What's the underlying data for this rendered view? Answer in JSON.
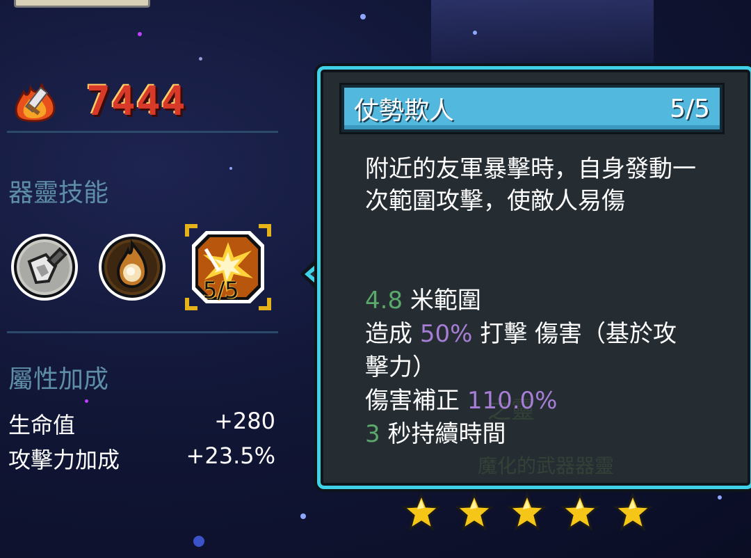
{
  "power": {
    "value": "7444",
    "icon": "flame-sword-icon"
  },
  "left": {
    "skills_title": "器靈技能",
    "skills": [
      {
        "name": "shovel-skill-icon",
        "level": ""
      },
      {
        "name": "fireball-skill-icon",
        "level": ""
      },
      {
        "name": "burst-skill-icon",
        "level": "5/5",
        "selected": true
      }
    ],
    "attr_title": "屬性加成",
    "attrs": [
      {
        "label": "生命值",
        "value": "+280"
      },
      {
        "label": "攻擊力加成",
        "value": "+23.5%"
      }
    ]
  },
  "tooltip": {
    "title": "仗勢欺人",
    "level": "5/5",
    "description": "附近的友軍暴擊時，自身發動一次範圍攻擊，使敵人易傷",
    "stats": {
      "range_value": "4.8",
      "range_label": "米範圍",
      "deal_prefix": "造成",
      "deal_value": "50%",
      "deal_suffix": "打擊 傷害（基於攻擊力）",
      "mod_label": "傷害補正",
      "mod_value": "110.0%",
      "dur_value": "3",
      "dur_label": "秒持續時間"
    },
    "background_ghost": {
      "line1": "之靈",
      "line2": "魔化的武器器靈"
    }
  },
  "rating": {
    "stars": 5,
    "filled": 5
  },
  "colors": {
    "accent": "#3fd1e8",
    "power": "#d83a2a",
    "green": "#5aa86a",
    "purple": "#a77ed6",
    "title_bar": "#52b8de"
  }
}
